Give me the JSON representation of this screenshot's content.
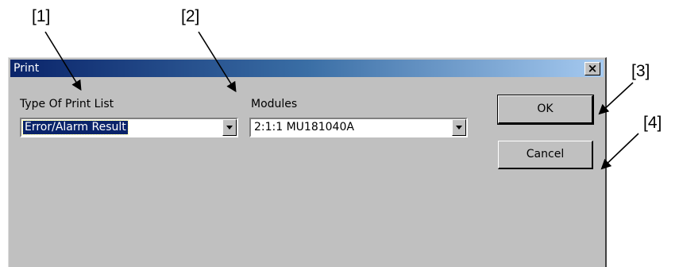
{
  "callouts": {
    "c1": "[1]",
    "c2": "[2]",
    "c3": "[3]",
    "c4": "[4]"
  },
  "dialog": {
    "title": "Print",
    "close_label": "x",
    "print_list_label": "Type Of Print List",
    "print_list_value": "Error/Alarm Result",
    "modules_label": "Modules",
    "modules_value": "2:1:1 MU181040A",
    "ok_label": "OK",
    "cancel_label": "Cancel"
  },
  "colors": {
    "title_bar_start": "#0a246a",
    "title_bar_end": "#a6caf0",
    "dialog_face": "#c0c0c0",
    "selection": "#0a246a"
  }
}
